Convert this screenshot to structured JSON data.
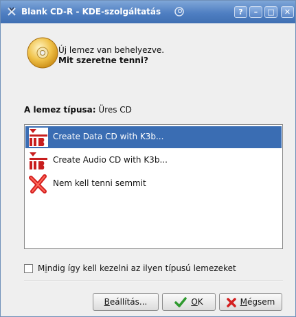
{
  "window": {
    "title": "Blank CD-R - KDE-szolgáltatás",
    "controls": [
      "?",
      "–",
      "□",
      "✕"
    ]
  },
  "header": {
    "line1": "Új lemez van behelyezve.",
    "line2": "Mit szeretne tenni?"
  },
  "disc_type": {
    "label": "A lemez típusa:",
    "value": "Üres CD"
  },
  "actions": [
    {
      "label": "Create Data CD with K3b...",
      "icon": "k3b-icon",
      "selected": true
    },
    {
      "label": "Create Audio CD with K3b...",
      "icon": "k3b-icon",
      "selected": false
    },
    {
      "label": "Nem kell tenni semmit",
      "icon": "red-x-icon",
      "selected": false
    }
  ],
  "checkbox": {
    "label_prefix": "M",
    "label_mnemonic": "i",
    "label_rest": "ndig így kell kezelni az ilyen típusú lemezeket",
    "checked": false
  },
  "buttons": {
    "settings": {
      "mnemonic": "B",
      "rest": "eállítás..."
    },
    "ok": {
      "mnemonic": "O",
      "rest": "K"
    },
    "cancel": {
      "mnemonic": "M",
      "rest": "égsem"
    }
  },
  "colors": {
    "titlebar": "#4f7fc2",
    "selection": "#3a6db3"
  }
}
